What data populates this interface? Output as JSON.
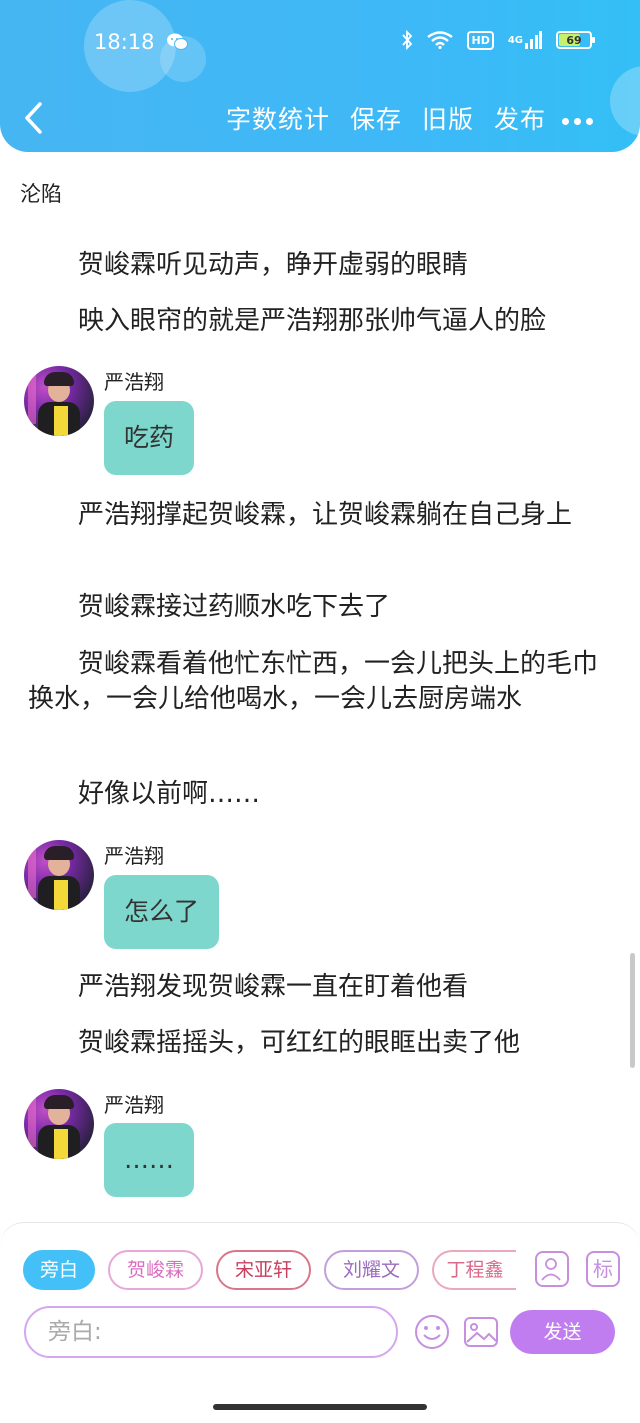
{
  "status_bar": {
    "time": "18:18",
    "network": "4G",
    "hd_label": "HD",
    "battery": "69"
  },
  "toolbar": {
    "word_count": "字数统计",
    "save": "保存",
    "old_version": "旧版",
    "publish": "发布"
  },
  "chapter_title": "沦陷",
  "story": {
    "p1": "贺峻霖听见动声，睁开虚弱的眼睛",
    "p2": "映入眼帘的就是严浩翔那张帅气逼人的脸",
    "msg1_name": "严浩翔",
    "msg1_text": "吃药",
    "p3": "严浩翔撑起贺峻霖，让贺峻霖躺在自己身上",
    "p4": "贺峻霖接过药顺水吃下去了",
    "p5": "贺峻霖看着他忙东忙西，一会儿把头上的毛巾换水，一会儿给他喝水，一会儿去厨房端水",
    "p6": "好像以前啊……",
    "msg2_name": "严浩翔",
    "msg2_text": "怎么了",
    "p7": "严浩翔发现贺峻霖一直在盯着他看",
    "p8": "贺峻霖摇摇头，可红红的眼眶出卖了他",
    "msg3_name": "严浩翔",
    "msg3_text": "……"
  },
  "roles": {
    "narrator": "旁白",
    "r1": "贺峻霖",
    "r2": "宋亚轩",
    "r3": "刘耀文",
    "r4": "丁程鑫",
    "mark_label": "标"
  },
  "input": {
    "placeholder": "旁白:",
    "send": "发送"
  },
  "colors": {
    "header": "#3fb8f7",
    "bubble": "#7ed7cc",
    "send": "#c07df0",
    "tag_active": "#43c0f7"
  }
}
